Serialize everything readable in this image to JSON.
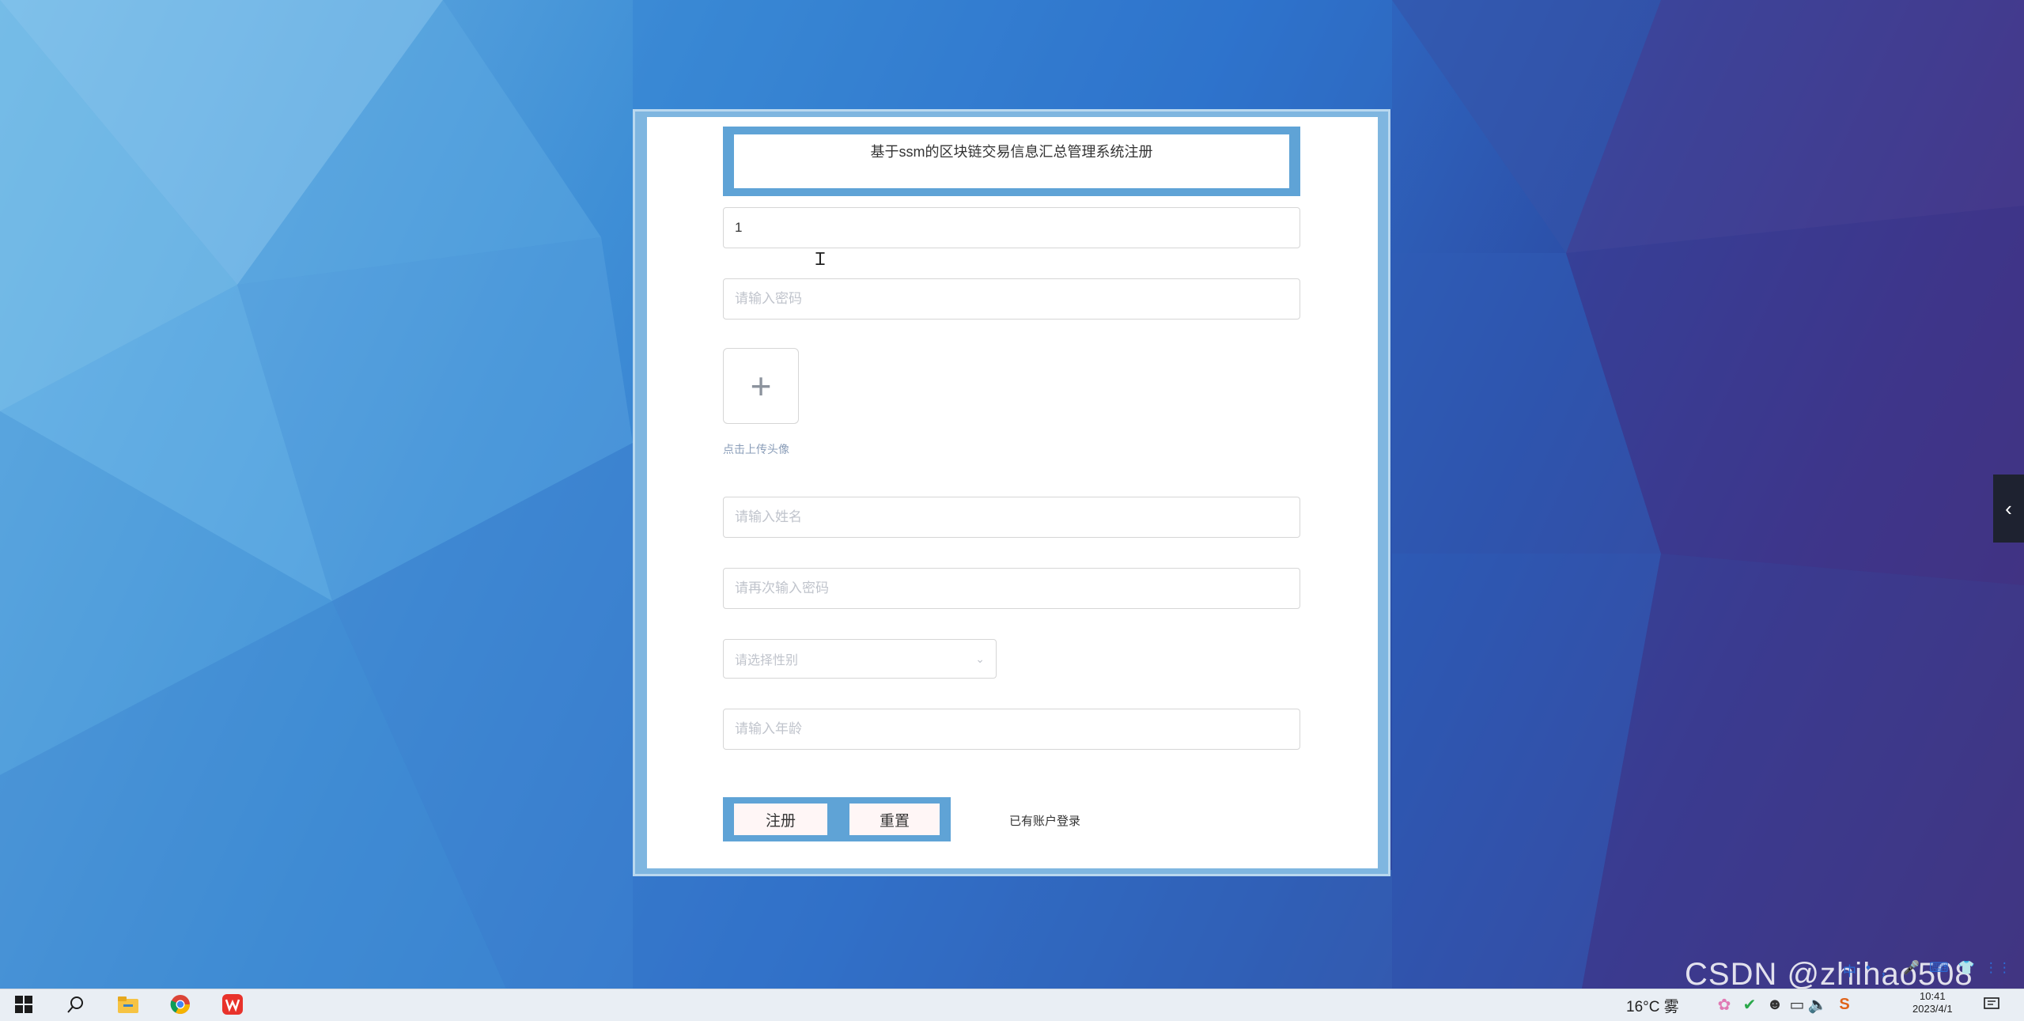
{
  "form": {
    "title": "基于ssm的区块链交易信息汇总管理系统注册",
    "account_value": "1",
    "password_placeholder": "请输入密码",
    "upload_hint": "点击上传头像",
    "name_placeholder": "请输入姓名",
    "confirm_password_placeholder": "请再次输入密码",
    "gender_placeholder": "请选择性别",
    "age_placeholder": "请输入年龄",
    "register_label": "注册",
    "reset_label": "重置",
    "login_link": "已有账户登录"
  },
  "taskbar": {
    "weather": "16°C 雾",
    "time": "10:41",
    "date": "2023/4/1"
  },
  "ime": [
    "中",
    "•",
    "，",
    "🎤",
    "⌨",
    "👕",
    "⋮⋮"
  ],
  "watermark": "CSDN @zhihao508",
  "colors": {
    "frame": "#5fa3d6",
    "button_bg": "#fff6f6"
  }
}
